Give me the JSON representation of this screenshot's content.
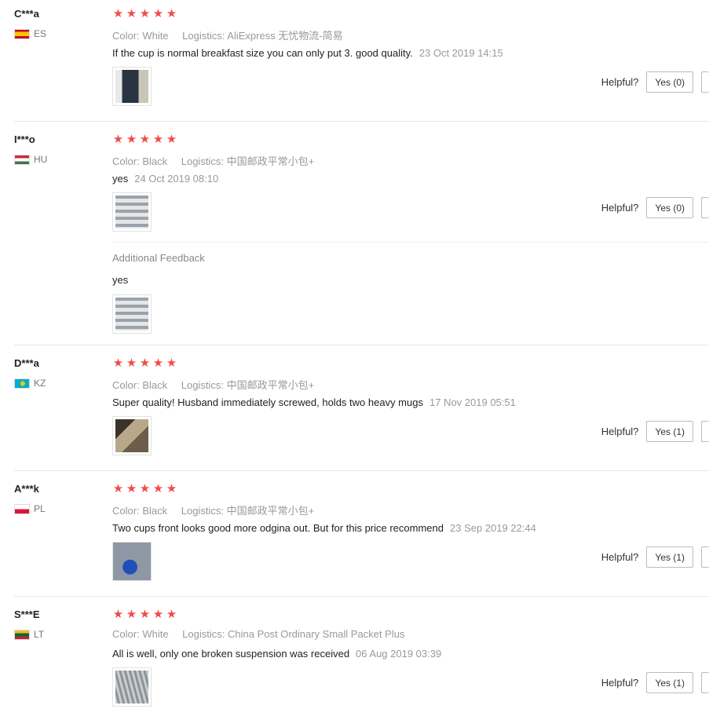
{
  "labels": {
    "color": "Color:",
    "logistics": "Logistics:",
    "helpful": "Helpful?",
    "additional_feedback": "Additional Feedback"
  },
  "star_count": 5,
  "star_color": "#ee4d4d",
  "reviews": [
    {
      "user": "C***a",
      "country": "ES",
      "flag": "es-flag",
      "stars": 5,
      "color": "White",
      "logistics": "AliExpress 无忧物流-简易",
      "text": "If the cup is normal breakfast size you can only put 3. good quality.",
      "date": "23 Oct 2019 14:15",
      "yes_label": "Yes (0)"
    },
    {
      "user": "I***o",
      "country": "HU",
      "flag": "hu-flag",
      "stars": 5,
      "color": "Black",
      "logistics": "中国邮政平常小包+",
      "text": "yes",
      "date": "24 Oct 2019 08:10",
      "yes_label": "Yes (0)",
      "additional_feedback": "yes"
    },
    {
      "user": "D***a",
      "country": "KZ",
      "flag": "kz-flag",
      "stars": 5,
      "color": "Black",
      "logistics": "中国邮政平常小包+",
      "text": "Super quality! Husband immediately screwed, holds two heavy mugs",
      "date": "17 Nov 2019 05:51",
      "yes_label": "Yes (1)"
    },
    {
      "user": "A***k",
      "country": "PL",
      "flag": "pl-flag",
      "stars": 5,
      "color": "Black",
      "logistics": "中国邮政平常小包+",
      "text": "Two cups front looks good more odgina out. But for this price recommend",
      "date": "23 Sep 2019 22:44",
      "yes_label": "Yes (1)"
    },
    {
      "user": "S***E",
      "country": "LT",
      "flag": "lt-flag",
      "stars": 5,
      "color": "White",
      "logistics": "China Post Ordinary Small Packet Plus",
      "text": "All is well, only one broken suspension was received",
      "date": "06 Aug 2019 03:39",
      "yes_label": "Yes (1)"
    }
  ]
}
